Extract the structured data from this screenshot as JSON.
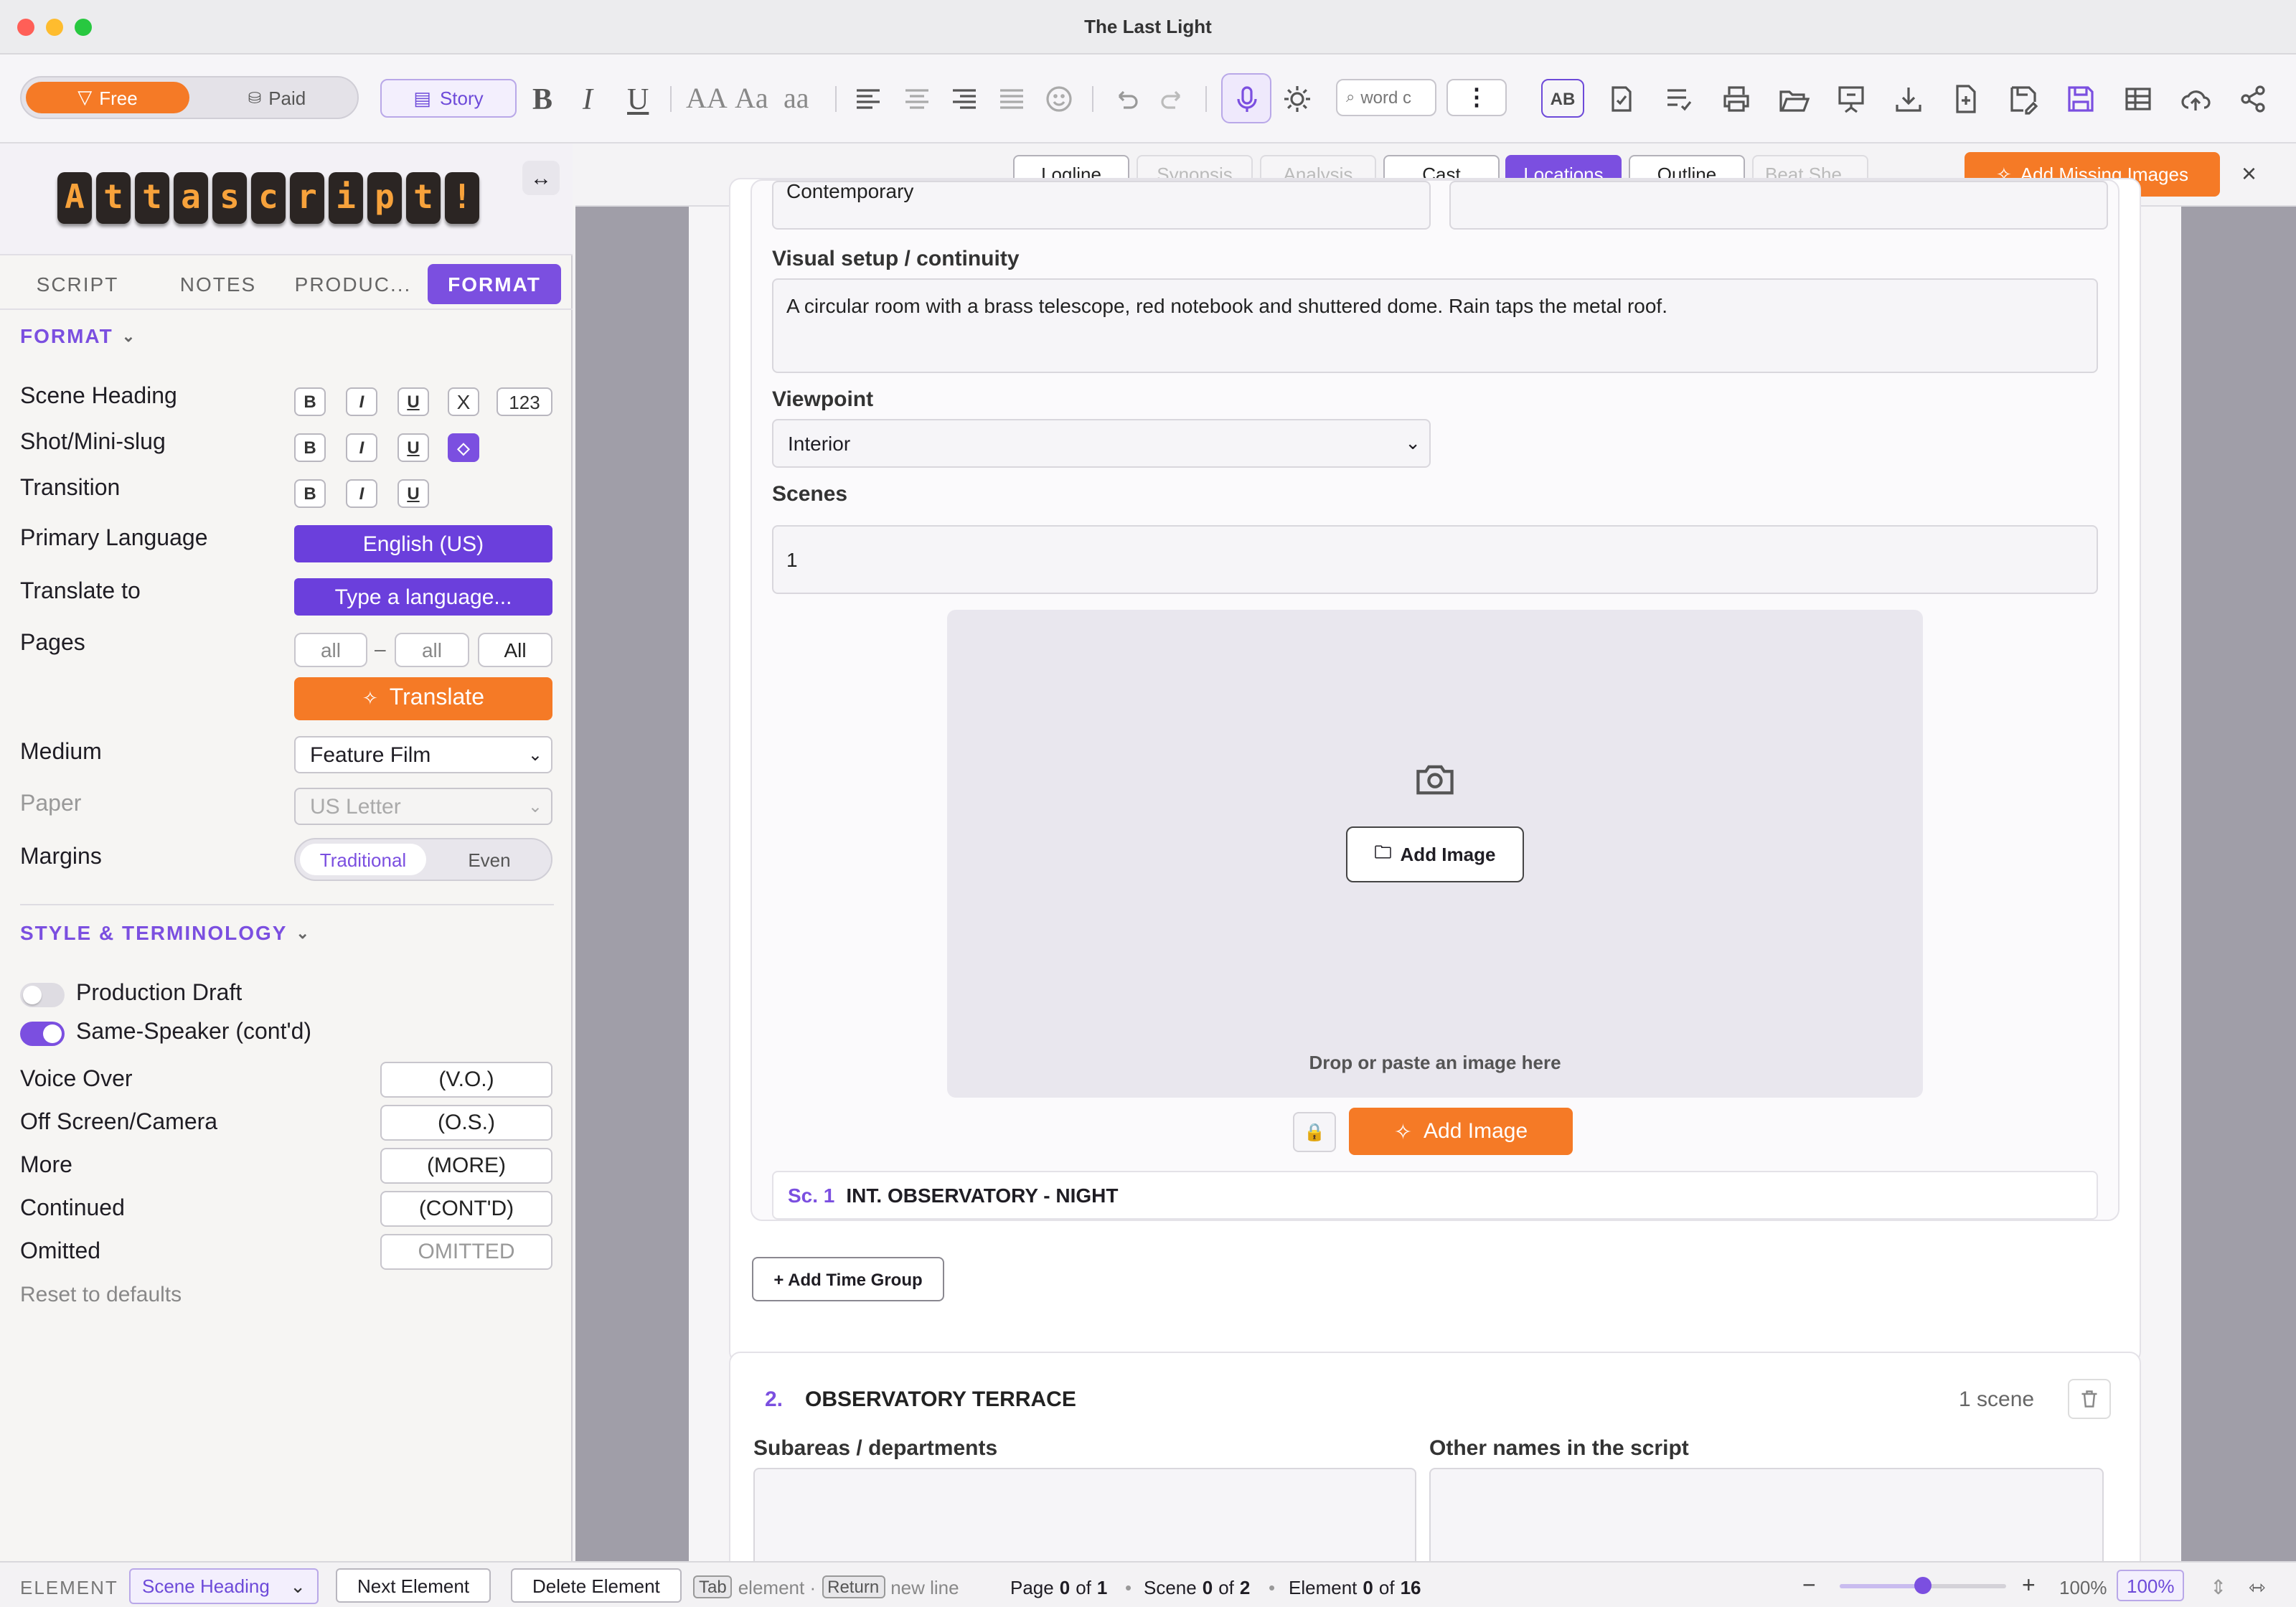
{
  "window": {
    "title": "The Last Light"
  },
  "toolbar": {
    "plan_free": "Free",
    "plan_paid": "Paid",
    "story_label": "Story",
    "bold": "B",
    "italic": "I",
    "underline": "U",
    "case_upper": "AA",
    "case_title": "Aa",
    "case_lower": "aa",
    "search_placeholder": "word c",
    "spell_label": "AB"
  },
  "sidebar": {
    "logo_letters": [
      "A",
      "t",
      "t",
      "a",
      "s",
      "c",
      "r",
      "i",
      "p",
      "t",
      "!"
    ],
    "expand_icon": "↔",
    "tabs": [
      "SCRIPT",
      "NOTES",
      "PRODUC...",
      "FORMAT"
    ],
    "format_section": "FORMAT",
    "rows": {
      "scene_heading": "Scene Heading",
      "shot": "Shot/Mini-slug",
      "transition": "Transition",
      "primary_language": "Primary Language",
      "translate_to": "Translate to",
      "pages": "Pages",
      "medium": "Medium",
      "paper": "Paper",
      "margins": "Margins"
    },
    "fmt_buttons": {
      "b": "B",
      "i": "I",
      "u": "U",
      "x": "X",
      "num": "123"
    },
    "primary_language_value": "English (US)",
    "translate_placeholder": "Type a language...",
    "pages_from": "all",
    "pages_dash": "–",
    "pages_to": "all",
    "pages_all": "All",
    "translate_button": "Translate",
    "medium_value": "Feature Film",
    "paper_value": "US Letter",
    "margins_a": "Traditional",
    "margins_b": "Even",
    "style_section": "STYLE & TERMINOLOGY",
    "production_draft": "Production Draft",
    "same_speaker": "Same-Speaker (cont'd)",
    "terms": [
      {
        "label": "Voice Over",
        "value": "(V.O.)"
      },
      {
        "label": "Off Screen/Camera",
        "value": "(O.S.)"
      },
      {
        "label": "More",
        "value": "(MORE)"
      },
      {
        "label": "Continued",
        "value": "(CONT'D)"
      },
      {
        "label": "Omitted",
        "value": "OMITTED"
      }
    ],
    "reset": "Reset to defaults",
    "toggles": {
      "production_draft_on": false,
      "same_speaker_on": true
    }
  },
  "main": {
    "subtabs": [
      "Logline",
      "Synopsis",
      "Analysis",
      "Cast",
      "Locations",
      "Outline",
      "Beat She..."
    ],
    "active_subtab": "Locations",
    "add_missing": "Add Missing Images",
    "close": "×",
    "partial_field": "Contemporary",
    "visual_label": "Visual setup / continuity",
    "visual_value": "A circular room with a brass telescope, red notebook and shuttered dome. Rain taps the metal roof.",
    "viewpoint_label": "Viewpoint",
    "viewpoint_value": "Interior",
    "scenes_label": "Scenes",
    "scenes_value": "1",
    "add_image_inner": "Add Image",
    "drop_text": "Drop or paste an image here",
    "add_image_orange": "Add Image",
    "scene_num": "Sc. 1",
    "scene_heading": "INT. OBSERVATORY - NIGHT",
    "add_time_group": "+ Add Time Group",
    "location2": {
      "num": "2.",
      "name": "OBSERVATORY TERRACE",
      "scene_count": "1 scene",
      "subareas_label": "Subareas / departments",
      "other_names_label": "Other names in the script"
    }
  },
  "statusbar": {
    "element_label": "ELEMENT",
    "element_value": "Scene Heading",
    "next_element": "Next Element",
    "delete_element": "Delete Element",
    "tab_key": "Tab",
    "tab_hint": "element ·",
    "return_key": "Return",
    "return_hint": "new line",
    "page_info": "Page",
    "page_cur": "0",
    "of": "of",
    "page_total": "1",
    "scene_info": "Scene",
    "scene_cur": "0",
    "scene_total": "2",
    "element_info": "Element",
    "element_cur": "0",
    "element_total": "16",
    "zoom_text": "100%",
    "zoom_badge": "100%",
    "zoom_level": 0.5
  },
  "colors": {
    "accent_purple": "#7b4fe0",
    "accent_orange": "#f57a26"
  }
}
